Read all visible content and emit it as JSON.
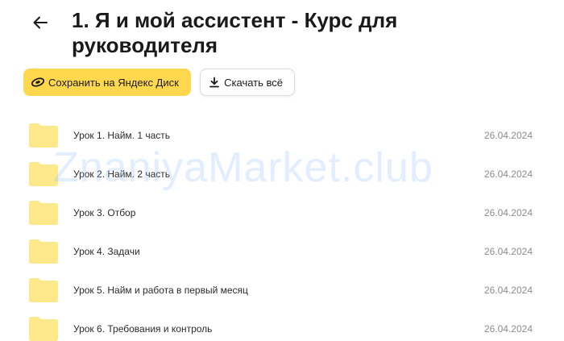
{
  "header": {
    "back_icon": "arrow-left-icon",
    "title": "1. Я и мой ассистент - Курс для руководителя"
  },
  "actions": {
    "save_label": "Сохранить на Яндекс Диск",
    "save_icon": "yandex-disk-icon",
    "download_label": "Скачать всё",
    "download_icon": "download-icon"
  },
  "files": [
    {
      "name": "Урок 1. Найм. 1 часть",
      "date": "26.04.2024",
      "icon": "folder-icon"
    },
    {
      "name": "Урок 2. Найм. 2 часть",
      "date": "26.04.2024",
      "icon": "folder-icon"
    },
    {
      "name": "Урок 3. Отбор",
      "date": "26.04.2024",
      "icon": "folder-icon"
    },
    {
      "name": "Урок 4. Задачи",
      "date": "26.04.2024",
      "icon": "folder-icon"
    },
    {
      "name": "Урок 5. Найм и работа в первый месяц",
      "date": "26.04.2024",
      "icon": "folder-icon"
    },
    {
      "name": "Урок 6. Требования и контроль",
      "date": "26.04.2024",
      "icon": "folder-icon"
    }
  ],
  "watermark": "ZnaniyaMarket.club",
  "colors": {
    "accent": "#ffd84d",
    "folder": "#fde98a",
    "date_text": "#8c8c8c"
  }
}
